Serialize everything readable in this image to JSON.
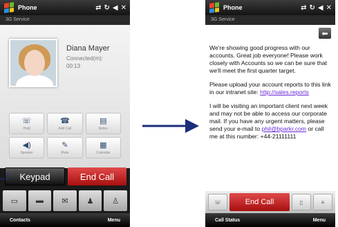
{
  "left_phone": {
    "app_title": "Phone",
    "status_icons": [
      "signal-icon",
      "sync-icon",
      "volume-icon",
      "close-icon"
    ],
    "carrier": "3G Service",
    "contact_name": "Diana Mayer",
    "call_status": "Connected(m):",
    "call_timer": "00:13",
    "buttons": [
      {
        "label": "Hold",
        "icon": "phone-hold-icon",
        "glyph": "☏"
      },
      {
        "label": "Add Call",
        "icon": "add-call-icon",
        "glyph": "☎"
      },
      {
        "label": "Notes",
        "icon": "notes-icon",
        "glyph": "▤"
      },
      {
        "label": "Speaker",
        "icon": "speaker-icon",
        "glyph": "◀)"
      },
      {
        "label": "Mute",
        "icon": "mute-icon",
        "glyph": "✎"
      },
      {
        "label": "Calendar",
        "icon": "calendar-icon",
        "glyph": "▦"
      }
    ],
    "keypad_label": "Keypad",
    "end_call_label": "End Call",
    "toolbar": [
      {
        "icon": "contact-card-icon",
        "glyph": "▭"
      },
      {
        "icon": "message-icon",
        "glyph": "▬"
      },
      {
        "icon": "mail-icon",
        "glyph": "✉"
      },
      {
        "icon": "contact-icon",
        "glyph": "♟"
      },
      {
        "icon": "add-contact-icon",
        "glyph": "♙"
      }
    ],
    "softkey_left": "Contacts",
    "softkey_right": "Menu"
  },
  "right_phone": {
    "app_title": "Phone",
    "status_icons": [
      "signal-icon",
      "sync-icon",
      "volume-icon",
      "close-icon"
    ],
    "carrier": "3G Service",
    "message": {
      "p1": "We're showing good progress with our accounts. Great job everyone! Please work closely with Accounts so we can be sure that we'll meet the first quarter target.",
      "p2_text": "Please upload your account reports to this link in our intranet site: ",
      "p2_link": "http://sales.reports",
      "p3_text": "I will be visiting an important client next week and may not be able to access our corporate mail. If you have any urgent matters, please send your e-mail to ",
      "p3_link": "phil@bparkr.com",
      "p3_tail": " or call me at this number: +44-21111111"
    },
    "end_call_label": "End Call",
    "softkey_left": "Call Status",
    "softkey_right": "Menu"
  },
  "colors": {
    "accent_red": "#c0161a",
    "link": "#6a2ad8",
    "arrow": "#1a2e7a"
  }
}
